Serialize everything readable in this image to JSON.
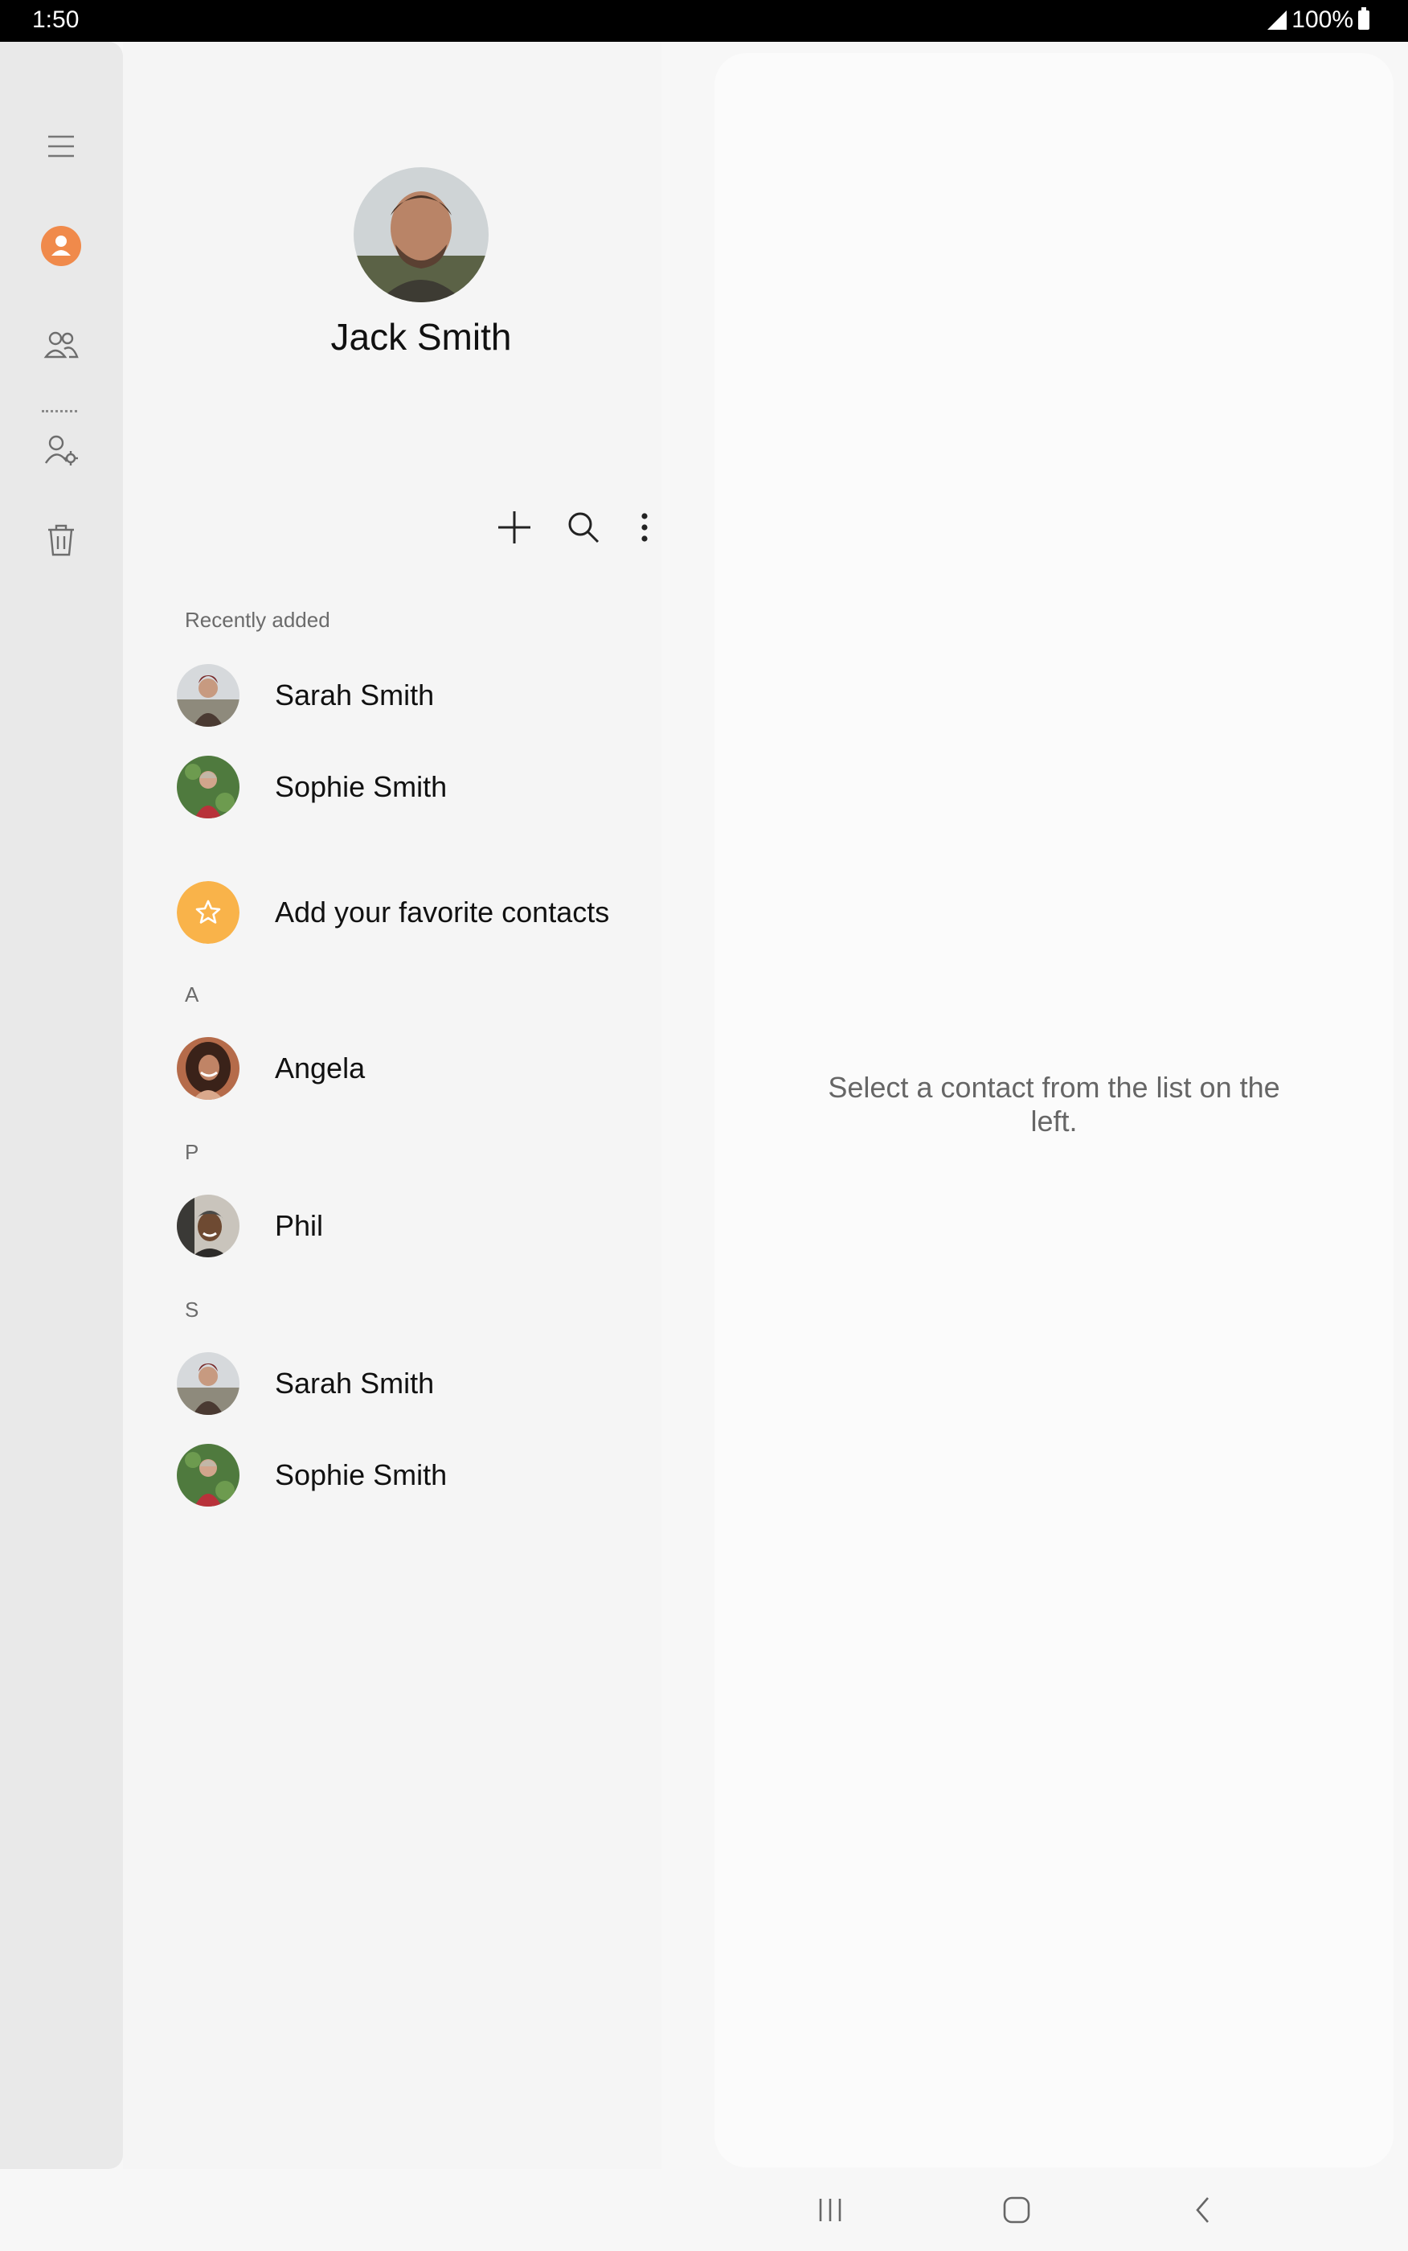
{
  "status_bar": {
    "time": "1:50",
    "battery": "100%"
  },
  "rail": {
    "items": [
      {
        "name": "menu"
      },
      {
        "name": "contacts"
      },
      {
        "name": "groups"
      },
      {
        "name": "manage-contacts"
      },
      {
        "name": "trash"
      }
    ],
    "accent_color": "#f08a4b"
  },
  "profile": {
    "name": "Jack Smith"
  },
  "toolbar": {
    "add": "add-icon",
    "search": "search-icon",
    "more": "more-options-icon"
  },
  "recently_added": {
    "label": "Recently added",
    "contacts": [
      {
        "name": "Sarah Smith"
      },
      {
        "name": "Sophie Smith"
      }
    ]
  },
  "favorites": {
    "label": "Add your favorite contacts",
    "color": "#f9b34a"
  },
  "groups": [
    {
      "letter": "A",
      "contacts": [
        {
          "name": "Angela"
        }
      ]
    },
    {
      "letter": "P",
      "contacts": [
        {
          "name": "Phil"
        }
      ]
    },
    {
      "letter": "S",
      "contacts": [
        {
          "name": "Sarah Smith"
        },
        {
          "name": "Sophie Smith"
        }
      ]
    }
  ],
  "detail": {
    "placeholder_line1": "Select a contact from the list on the",
    "placeholder_line2": "left."
  },
  "navbar": {
    "recents": "recents-icon",
    "home": "home-icon",
    "back": "back-icon"
  }
}
